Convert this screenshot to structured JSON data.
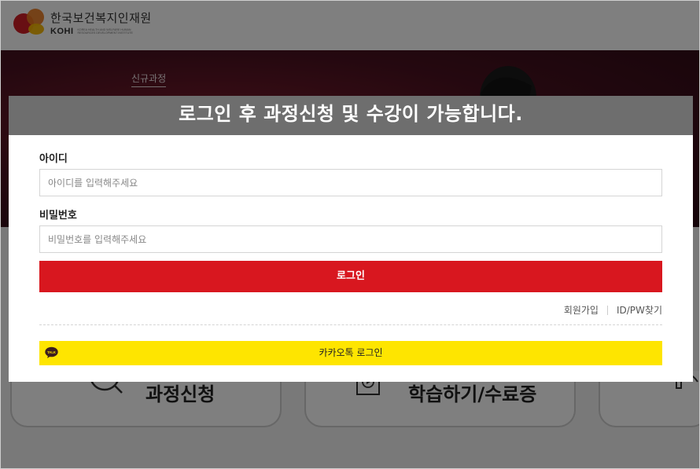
{
  "header": {
    "org_name_ko": "한국보건복지인재원",
    "org_name_en": "KOHI",
    "org_sub": "KOREA HEALTH AND WELFARE HUMAN RESOURCES DEVELOPMENT INSTITUTE"
  },
  "hero": {
    "tag": "신규과정"
  },
  "cards": [
    {
      "label": "과정신청"
    },
    {
      "label": "학습하기/수료증"
    }
  ],
  "modal": {
    "title": "로그인 후 과정신청 및 수강이 가능합니다.",
    "id_label": "아이디",
    "id_placeholder": "아이디를 입력해주세요",
    "pw_label": "비밀번호",
    "pw_placeholder": "비밀번호를 입력해주세요",
    "login_button": "로그인",
    "join_link": "회원가입",
    "find_link": "ID/PW찾기",
    "kakao_button": "카카오톡 로그인",
    "kakao_icon_text": "TALK"
  },
  "colors": {
    "login_red": "#d8171f",
    "kakao_yellow": "#fee500",
    "modal_header": "#6e6e6e"
  }
}
